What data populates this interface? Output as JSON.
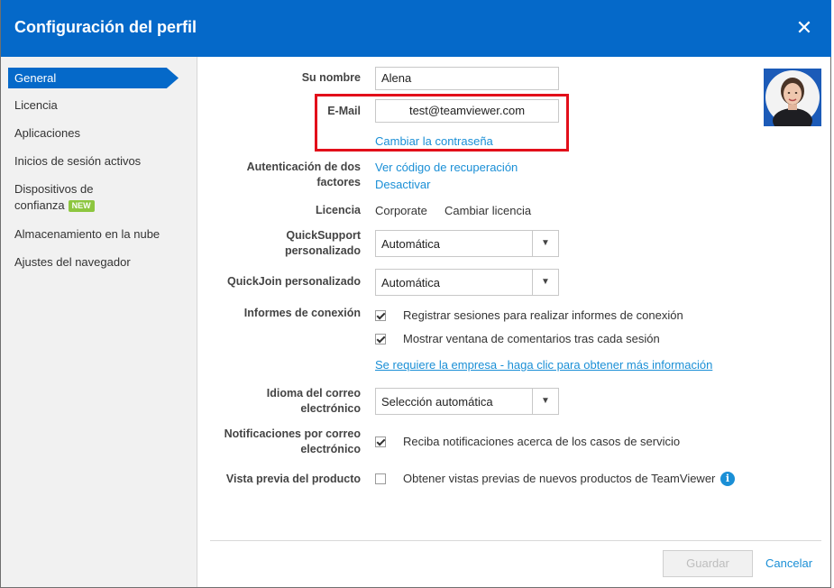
{
  "dialog": {
    "title": "Configuración del perfil",
    "close_icon": "close-icon"
  },
  "sidebar": {
    "items": [
      {
        "label": "General",
        "active": true
      },
      {
        "label": "Licencia"
      },
      {
        "label": "Aplicaciones"
      },
      {
        "label": "Inicios de sesión activos"
      },
      {
        "label": "Dispositivos de",
        "label2": "confianza",
        "badge": "NEW"
      },
      {
        "label": "Almacenamiento en la nube"
      },
      {
        "label": "Ajustes del navegador"
      }
    ]
  },
  "form": {
    "name": {
      "label": "Su nombre",
      "value": "Alena"
    },
    "email": {
      "label": "E-Mail",
      "value": "test@teamviewer.com",
      "change_password": "Cambiar la contraseña"
    },
    "two_factor": {
      "label1": "Autenticación de dos",
      "label2": "factores",
      "recovery_link": "Ver código de recuperación",
      "deactivate_link": "Desactivar"
    },
    "license": {
      "label": "Licencia",
      "value": "Corporate",
      "change": "Cambiar licencia"
    },
    "quicksupport": {
      "label1": "QuickSupport",
      "label2": "personalizado",
      "value": "Automática"
    },
    "quickjoin": {
      "label": "QuickJoin personalizado",
      "value": "Automática"
    },
    "connection_reports": {
      "label": "Informes de conexión",
      "options": [
        {
          "text": "Registrar sesiones para realizar informes de conexión",
          "checked": true
        },
        {
          "text": "Mostrar ventana de comentarios tras cada sesión",
          "checked": true
        }
      ],
      "company_link": "Se requiere la empresa - haga clic para obtener más información"
    },
    "email_language": {
      "label1": "Idioma del correo",
      "label2": "electrónico",
      "value": "Selección automática"
    },
    "email_notifications": {
      "label1": "Notificaciones por correo",
      "label2": "electrónico",
      "option": "Reciba notificaciones acerca de los casos de servicio",
      "checked": true
    },
    "product_preview": {
      "label": "Vista previa del producto",
      "option": "Obtener vistas previas de nuevos productos de TeamViewer",
      "checked": false,
      "icon": "info-icon"
    }
  },
  "footer": {
    "save": "Guardar",
    "cancel": "Cancelar"
  },
  "colors": {
    "brand": "#0569c9",
    "link": "#1a8fd6",
    "highlight": "#e20f1a",
    "badge": "#8dc63f"
  }
}
